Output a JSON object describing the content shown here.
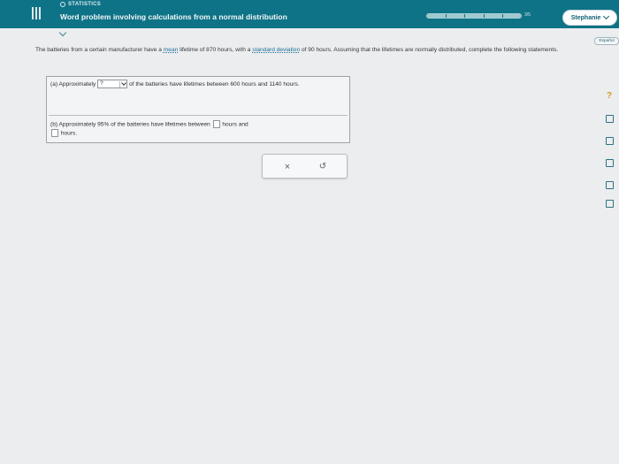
{
  "header": {
    "category": "STATISTICS",
    "title": "Word problem involving calculations from a normal distribution",
    "progress_label": "3/5",
    "progress_fraction": 1.0,
    "progress_segments": 5,
    "user_name": "Stephanie",
    "accent_color": "#0f7387"
  },
  "language_button": "Español",
  "problem": {
    "text_1": "The batteries from a certain manufacturer have a ",
    "link_mean": "mean",
    "text_2": " lifetime of 870 hours, with a ",
    "link_sd": "standard deviation",
    "text_3": " of 90 hours. Assuming that the lifetimes are normally distributed, complete the following statements."
  },
  "part_a": {
    "prefix": "(a) Approximately",
    "select_value": "?",
    "suffix": "of the batteries have lifetimes between 600 hours and 1140 hours."
  },
  "part_b": {
    "prefix": "(b) Approximately 95% of the batteries have lifetimes between",
    "middle": "hours and",
    "suffix": "hours."
  },
  "actions": {
    "clear_symbol": "×",
    "undo_symbol": "↺"
  },
  "rail": {
    "help_symbol": "?",
    "icons": [
      "help-icon",
      "calculator-icon",
      "video-icon",
      "data-table-icon",
      "book-icon",
      "mail-icon"
    ]
  }
}
